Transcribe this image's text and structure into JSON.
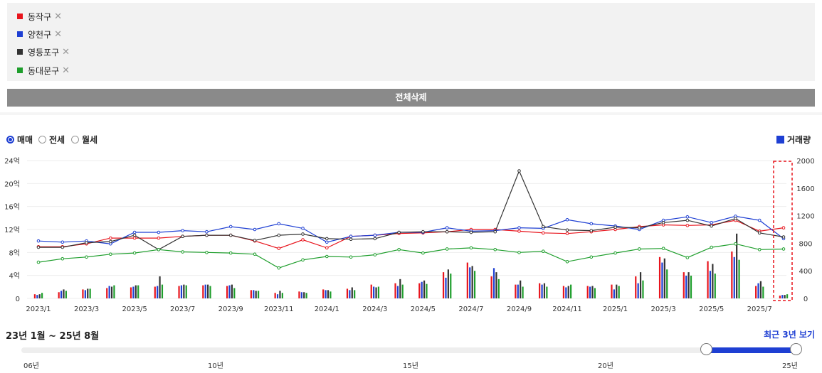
{
  "filters": [
    {
      "name": "동작구",
      "color": "#e8141c"
    },
    {
      "name": "양천구",
      "color": "#1e3fd3"
    },
    {
      "name": "영등포구",
      "color": "#333333"
    },
    {
      "name": "동대문구",
      "color": "#1e9e2c"
    }
  ],
  "remove_glyph": "✕",
  "clear_all_label": "전체삭제",
  "deal_types": [
    {
      "label": "매매",
      "selected": true
    },
    {
      "label": "전세",
      "selected": false
    },
    {
      "label": "월세",
      "selected": false
    }
  ],
  "volume_label": "거래량",
  "range_label": "23년 1월 ~ 25년 8월",
  "recent_label": "최근 3년 보기",
  "slider": {
    "ticks": [
      "06년",
      "10년",
      "15년",
      "20년",
      "25년"
    ]
  },
  "chart_data": {
    "type": "line",
    "x": [
      "2023/1",
      "2023/2",
      "2023/3",
      "2023/4",
      "2023/5",
      "2023/6",
      "2023/7",
      "2023/8",
      "2023/9",
      "2023/10",
      "2023/11",
      "2023/12",
      "2024/1",
      "2024/2",
      "2024/3",
      "2024/4",
      "2024/5",
      "2024/6",
      "2024/7",
      "2024/8",
      "2024/9",
      "2024/10",
      "2024/11",
      "2024/12",
      "2025/1",
      "2025/2",
      "2025/3",
      "2025/4",
      "2025/5",
      "2025/6",
      "2025/7",
      "2025/8"
    ],
    "x_tick_labels": [
      "2023/1",
      "2023/3",
      "2023/5",
      "2023/7",
      "2023/9",
      "2023/11",
      "2024/1",
      "2024/3",
      "2024/5",
      "2024/7",
      "2024/9",
      "2024/11",
      "2025/1",
      "2025/3",
      "2025/5",
      "2025/7"
    ],
    "y_left": {
      "ticks": [
        "0",
        "4억",
        "8억",
        "12억",
        "16억",
        "20억",
        "24억"
      ],
      "range": [
        0,
        24
      ]
    },
    "y_right": {
      "ticks": [
        "0",
        "400",
        "800",
        "1200",
        "1600",
        "2000"
      ],
      "range": [
        0,
        2000
      ]
    },
    "series": [
      {
        "name": "동작구",
        "color": "#e8141c",
        "price": [
          9.0,
          9.0,
          9.5,
          10.5,
          10.5,
          10.5,
          10.8,
          11.0,
          11.0,
          10.0,
          8.7,
          10.2,
          8.8,
          10.8,
          11.0,
          11.3,
          11.4,
          11.6,
          12.0,
          12.0,
          11.7,
          11.4,
          11.3,
          11.6,
          12.0,
          12.5,
          12.8,
          12.7,
          12.8,
          13.6,
          11.7,
          12.3
        ],
        "volume": [
          60,
          90,
          130,
          150,
          160,
          170,
          180,
          190,
          180,
          120,
          80,
          100,
          130,
          140,
          200,
          220,
          220,
          380,
          520,
          320,
          200,
          220,
          180,
          180,
          200,
          320,
          600,
          380,
          540,
          680,
          180,
          40
        ]
      },
      {
        "name": "양천구",
        "color": "#1e3fd3",
        "price": [
          10.0,
          9.8,
          10.0,
          9.5,
          11.5,
          11.5,
          11.8,
          11.6,
          12.5,
          12.0,
          13.0,
          12.2,
          9.8,
          10.8,
          11.0,
          11.5,
          11.5,
          12.3,
          11.7,
          11.8,
          12.3,
          12.2,
          13.7,
          13.0,
          12.6,
          12.0,
          13.6,
          14.2,
          13.2,
          14.3,
          13.6,
          10.4
        ],
        "volume": [
          50,
          110,
          120,
          180,
          170,
          180,
          190,
          200,
          190,
          120,
          60,
          90,
          120,
          120,
          170,
          180,
          240,
          300,
          450,
          440,
          200,
          200,
          160,
          170,
          130,
          220,
          520,
          330,
          400,
          600,
          220,
          50
        ]
      },
      {
        "name": "영등포구",
        "color": "#333333",
        "price": [
          8.9,
          8.9,
          9.7,
          9.9,
          11.0,
          8.5,
          10.8,
          11.0,
          11.0,
          10.1,
          11.0,
          11.2,
          10.4,
          10.3,
          10.4,
          11.5,
          11.6,
          11.6,
          11.5,
          11.6,
          22.2,
          12.5,
          11.9,
          11.8,
          12.4,
          12.3,
          13.2,
          13.6,
          12.6,
          13.9,
          11.4,
          10.7
        ],
        "volume": [
          60,
          130,
          140,
          170,
          190,
          320,
          200,
          200,
          200,
          110,
          110,
          90,
          120,
          160,
          160,
          280,
          260,
          420,
          470,
          380,
          260,
          220,
          180,
          180,
          200,
          380,
          580,
          380,
          500,
          940,
          250,
          50
        ]
      },
      {
        "name": "동대문구",
        "color": "#1e9e2c",
        "price": [
          6.3,
          6.9,
          7.2,
          7.7,
          7.9,
          8.5,
          8.1,
          8.0,
          7.9,
          7.7,
          5.3,
          6.7,
          7.3,
          7.2,
          7.6,
          8.5,
          7.9,
          8.6,
          8.8,
          8.5,
          8.0,
          8.2,
          6.4,
          7.2,
          7.9,
          8.6,
          8.7,
          7.1,
          8.9,
          9.5,
          8.5,
          8.6
        ],
        "volume": [
          80,
          110,
          140,
          190,
          190,
          200,
          190,
          180,
          150,
          110,
          80,
          80,
          100,
          120,
          170,
          200,
          210,
          360,
          400,
          280,
          170,
          170,
          200,
          150,
          180,
          260,
          420,
          330,
          360,
          560,
          170,
          60
        ]
      }
    ]
  }
}
